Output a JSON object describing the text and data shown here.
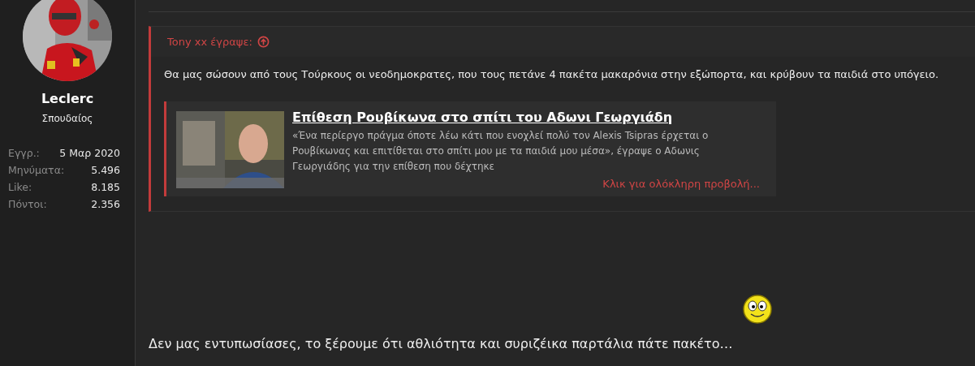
{
  "user": {
    "name": "Leclerc",
    "rank": "Σπουδαίος",
    "stats": [
      {
        "label": "Εγγρ.:",
        "value": "5 Μαρ 2020"
      },
      {
        "label": "Μηνύματα:",
        "value": "5.496"
      },
      {
        "label": "Like:",
        "value": "8.185"
      },
      {
        "label": "Πόντοι:",
        "value": "2.356"
      }
    ]
  },
  "quote": {
    "author": "Tony xx έγραψε:",
    "text": "Θα μας σώσουν από τους Τούρκους οι νεοδημοκρατες, που τους πετάνε 4 πακέτα μακαρόνια στην εξώπορτα, και κρύβουν τα παιδιά στο υπόγειο.",
    "embed": {
      "title": "Επίθεση Ρουβίκωνα στο σπίτι του Αδωνι Γεωργιάδη",
      "description": "«Ένα περίεργο πράγμα όποτε λέω κάτι που ενοχλεί πολύ τον Alexis Tsipras έρχεται ο Ρουβίκωνας και επιτίθεται στο σπίτι μου με τα παιδιά μου μέσα», έγραψε ο Αδωνις Γεωργιάδης για την επίθεση που δέχτηκε",
      "more": "Κλικ για ολόκληρη προβολή..."
    }
  },
  "reply": "Δεν μας εντυπωσίασες, το ξέρουμε ότι αθλιότητα και συριζέικα παρτάλια πάτε πακέτο…"
}
